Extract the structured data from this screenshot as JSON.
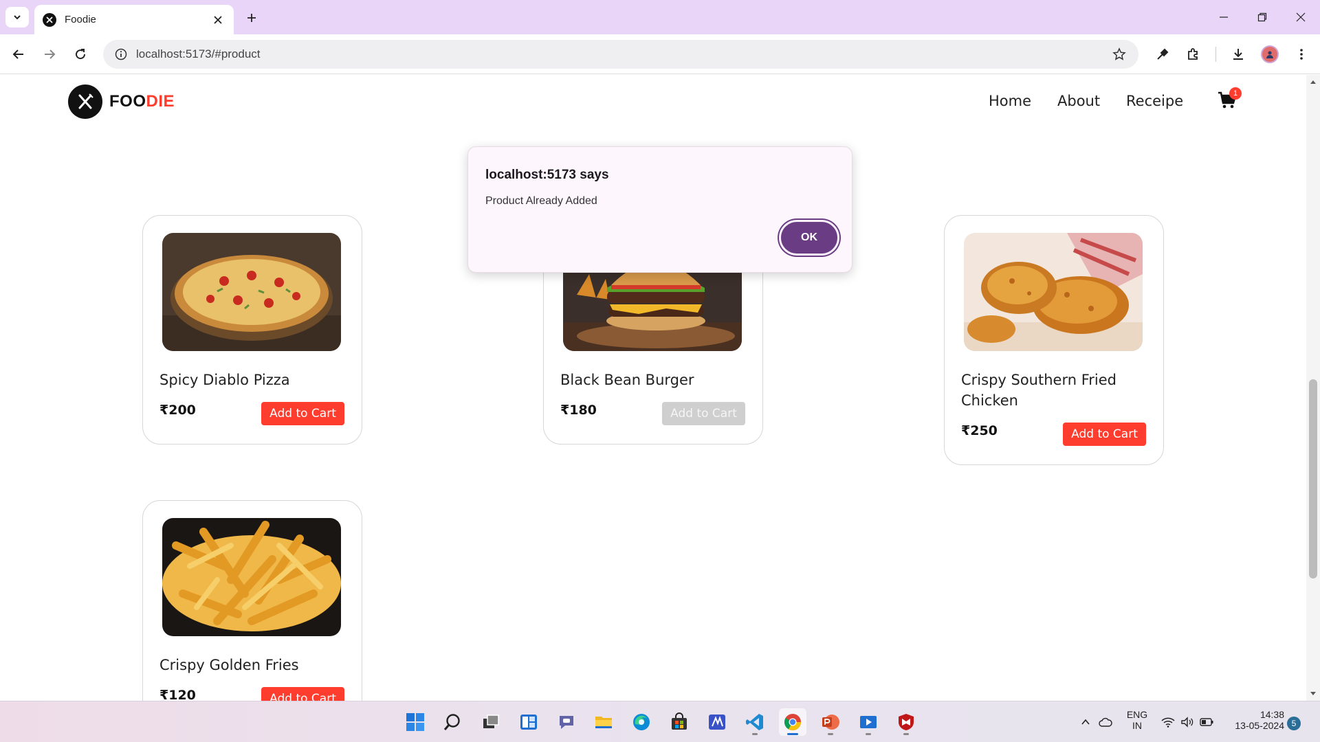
{
  "browser": {
    "tab_title": "Foodie",
    "url": "localhost:5173/#product"
  },
  "site": {
    "logo_part1": "FOO",
    "logo_part2": "DIE",
    "nav": [
      "Home",
      "About",
      "Receipe"
    ],
    "cart_count": "1",
    "brand_color": "#ff3d2e"
  },
  "products": [
    {
      "name": "Spicy Diablo Pizza",
      "price": "₹200",
      "button": "Add to Cart",
      "image_icon": "pizza-image",
      "button_enabled": true
    },
    {
      "name": "Black Bean Burger",
      "price": "₹180",
      "button": "Add to Cart",
      "image_icon": "burger-image",
      "button_enabled": false
    },
    {
      "name": "Crispy Southern Fried Chicken",
      "price": "₹250",
      "button": "Add to Cart",
      "image_icon": "fried-chicken-image",
      "button_enabled": true
    },
    {
      "name": "Crispy Golden Fries",
      "price": "₹120",
      "button": "Add to Cart",
      "image_icon": "fries-image",
      "button_enabled": true
    }
  ],
  "dialog": {
    "title": "localhost:5173 says",
    "message": "Product Already Added",
    "ok": "OK"
  },
  "taskbar": {
    "lang_line1": "ENG",
    "lang_line2": "IN",
    "time": "14:38",
    "date": "13-05-2024",
    "notification_count": "5"
  }
}
